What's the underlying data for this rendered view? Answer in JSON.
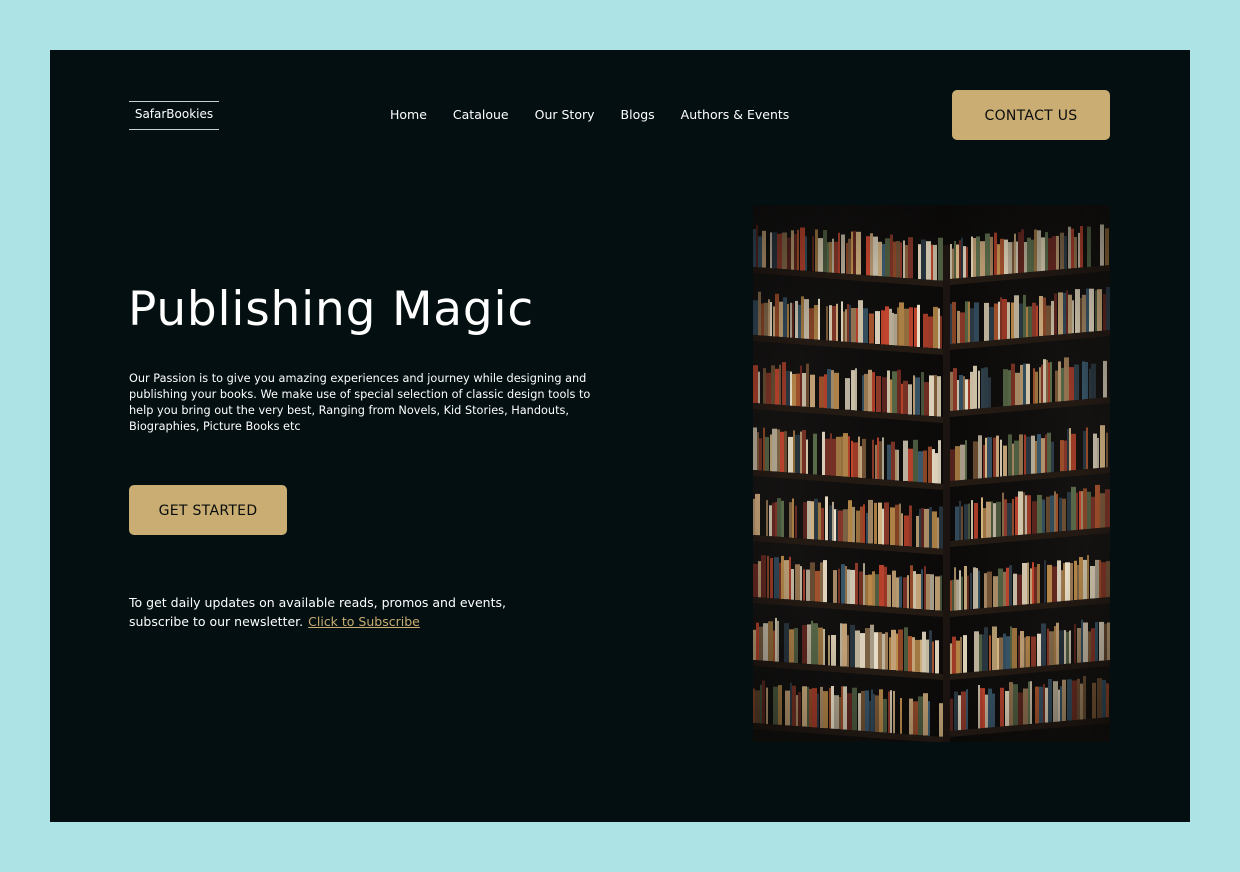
{
  "brand": {
    "logo": "SafarBookies"
  },
  "nav": {
    "items": [
      {
        "label": "Home"
      },
      {
        "label": "Cataloue"
      },
      {
        "label": "Our Story"
      },
      {
        "label": "Blogs"
      },
      {
        "label": "Authors & Events"
      }
    ],
    "contact_label": "CONTACT US"
  },
  "hero": {
    "title": "Publishing Magic",
    "description": "Our Passion is to give you amazing experiences and journey while designing and publishing your books. We make use of special selection of classic design tools to help you bring out the very best, Ranging from Novels, Kid Stories, Handouts, Biographies, Picture Books etc",
    "cta_label": "GET STARTED"
  },
  "newsletter": {
    "text": "To get daily updates on available reads, promos and events, subscribe to our newsletter.",
    "link_label": "Click to Subscribe"
  },
  "image": {
    "subject": "bookshelf-corner-photo"
  },
  "colors": {
    "frame": "#ade3e4",
    "page_background": "#030f10",
    "accent": "#c9ad72",
    "text": "#ffffff"
  }
}
